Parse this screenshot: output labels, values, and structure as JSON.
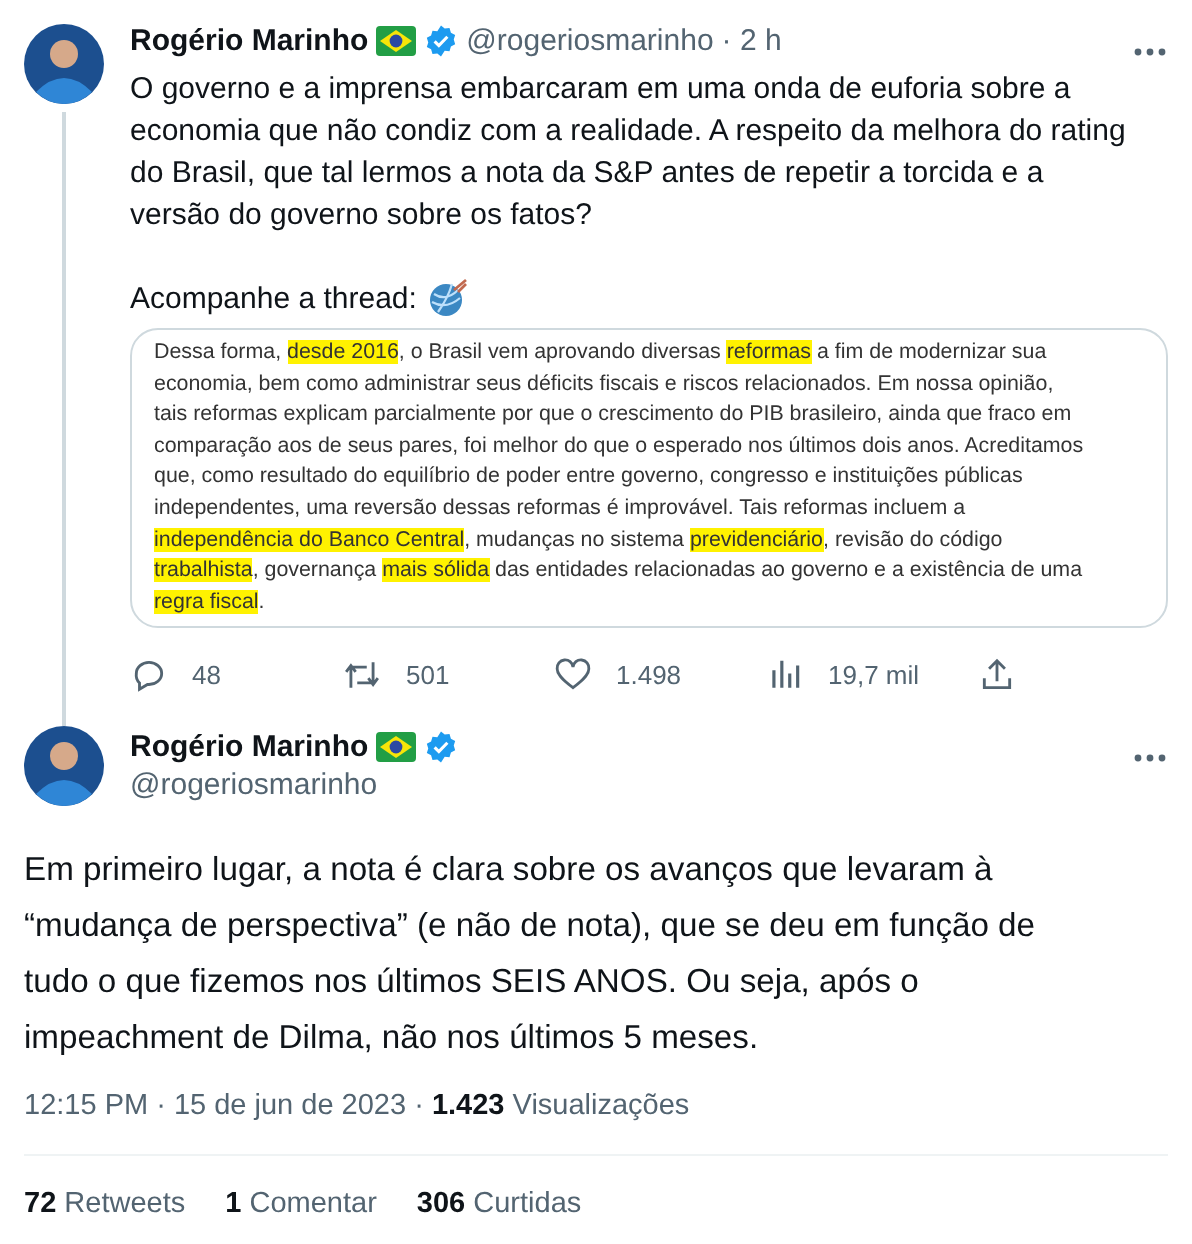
{
  "thread": [
    {
      "author": {
        "name": "Rogério Marinho",
        "handle": "@rogeriosmarinho",
        "time": "· 2 h",
        "verified": true
      },
      "text": "O governo e a imprensa embarcaram em uma onda de euforia sobre a economia que não condiz com a realidade. A respeito da melhora do rating do Brasil, que tal lermos a nota da S&P antes de repetir a torcida e a versão do governo sobre os fatos?",
      "thread_note": "Acompanhe a thread:",
      "document": {
        "lines": [
          [
            {
              "text": "Dessa forma, ",
              "highlight": false
            },
            {
              "text": "desde 2016",
              "highlight": true
            },
            {
              "text": ", o Brasil vem aprovando diversas ",
              "highlight": false
            },
            {
              "text": "reformas",
              "highlight": true
            },
            {
              "text": " a fim de modernizar sua",
              "highlight": false
            }
          ],
          [
            {
              "text": "economia, bem como administrar seus déficits fiscais e riscos relacionados. Em nossa opinião,",
              "highlight": false
            }
          ],
          [
            {
              "text": "tais reformas explicam parcialmente por que o crescimento do PIB brasileiro, ainda que fraco em",
              "highlight": false
            }
          ],
          [
            {
              "text": "comparação aos de seus pares, foi melhor do que o esperado nos últimos dois anos. Acreditamos",
              "highlight": false
            }
          ],
          [
            {
              "text": "que, como resultado do equilíbrio de poder entre governo, congresso e instituições públicas",
              "highlight": false
            }
          ],
          [
            {
              "text": "independentes, uma reversão dessas reformas é improvável. Tais reformas incluem a",
              "highlight": false
            }
          ],
          [
            {
              "text": "independência do Banco Central",
              "highlight": true
            },
            {
              "text": ", mudanças no sistema ",
              "highlight": false
            },
            {
              "text": "previdenciário",
              "highlight": true
            },
            {
              "text": ", revisão do código",
              "highlight": false
            }
          ],
          [
            {
              "text": "trabalhista",
              "highlight": true
            },
            {
              "text": ", governança ",
              "highlight": false
            },
            {
              "text": "mais sólida",
              "highlight": true
            },
            {
              "text": " das entidades relacionadas ao governo e a existência de uma",
              "highlight": false
            }
          ],
          [
            {
              "text": "regra fiscal",
              "highlight": true
            },
            {
              "text": ".",
              "highlight": false
            }
          ]
        ]
      },
      "actions": [
        {
          "kind": "reply",
          "count": "48"
        },
        {
          "kind": "retweet",
          "count": "501"
        },
        {
          "kind": "like",
          "count": "1.498"
        },
        {
          "kind": "views",
          "count": "19,7 mil"
        },
        {
          "kind": "share"
        }
      ]
    },
    {
      "author": {
        "name": "Rogério Marinho",
        "handle": "@rogeriosmarinho",
        "verified": true
      },
      "text": "Em primeiro lugar, a nota é clara sobre os avanços que levaram à “mudança de perspectiva” (e não de nota), que se deu em função de tudo o que fizemos nos últimos SEIS ANOS. Ou seja, após o impeachment de Dilma, não nos últimos 5 meses.",
      "meta": "12:15 PM · 15 de jun de 2023 · **1.423** Visualizações",
      "stats": [
        "**72** Retweets",
        "**1** Comentar",
        "**306** Curtidas"
      ]
    }
  ]
}
